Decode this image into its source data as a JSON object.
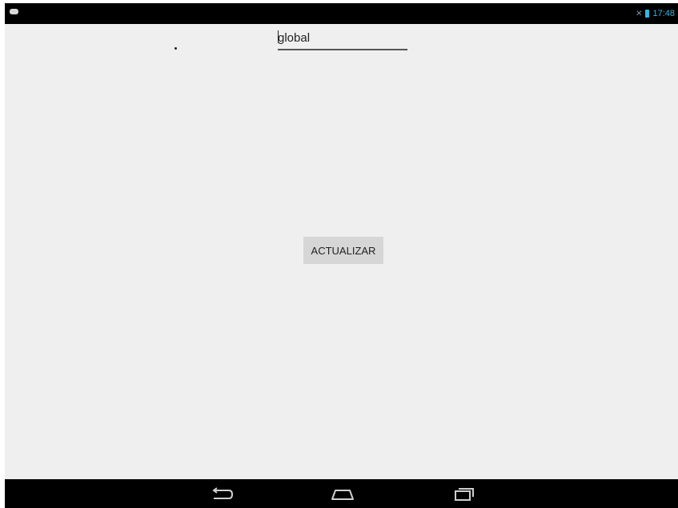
{
  "status_bar": {
    "time": "17:48",
    "icons": [
      "notification-icon",
      "signal-icon",
      "battery-icon"
    ],
    "accent_color": "#33b5e5"
  },
  "main": {
    "text_field": {
      "value": "global"
    },
    "button": {
      "label": "ACTUALIZAR"
    }
  },
  "nav_bar": {
    "buttons": [
      "back-icon",
      "home-icon",
      "recents-icon"
    ]
  }
}
